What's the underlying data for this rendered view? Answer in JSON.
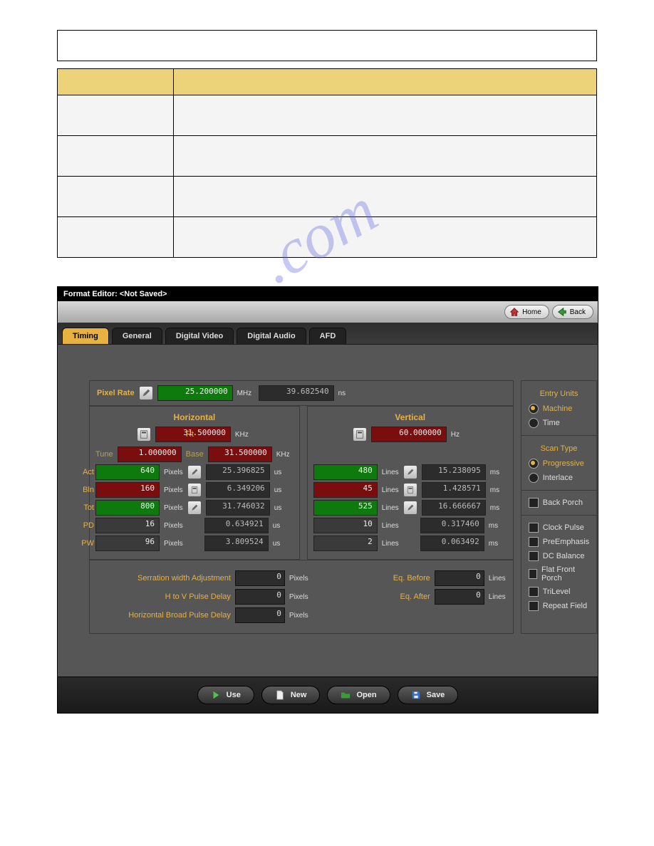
{
  "watermark": ".com",
  "editor": {
    "title": "Format Editor: <Not Saved>",
    "toolbar": {
      "home": "Home",
      "back": "Back"
    },
    "tabs": [
      "Timing",
      "General",
      "Digital Video",
      "Digital Audio",
      "AFD"
    ],
    "activeTab": 0,
    "pixelRate": {
      "label": "Pixel Rate",
      "value": "25.200000",
      "unit": "MHz",
      "secondary": "39.682540",
      "secondaryUnit": "ns"
    },
    "horizontal": {
      "heading": "Horizontal",
      "rtLabel": "Rt",
      "rt": {
        "value": "31.500000",
        "unit": "KHz"
      },
      "tuneLabel": "Tune",
      "tune": "1.000000",
      "baseLabel": "Base",
      "base": "31.500000",
      "baseUnit": "KHz"
    },
    "vertical": {
      "heading": "Vertical",
      "rt": {
        "value": "60.000000",
        "unit": "Hz"
      }
    },
    "rows": {
      "labels": {
        "act": "Act",
        "bln": "Bln",
        "tot": "Tot",
        "pd": "PD",
        "pw": "PW"
      },
      "pixelsUnit": "Pixels",
      "linesUnit": "Lines",
      "usUnit": "us",
      "msUnit": "ms",
      "h": {
        "act": {
          "v": "640",
          "t": "25.396825"
        },
        "bln": {
          "v": "160",
          "t": "6.349206"
        },
        "tot": {
          "v": "800",
          "t": "31.746032"
        },
        "pd": {
          "v": "16",
          "t": "0.634921"
        },
        "pw": {
          "v": "96",
          "t": "3.809524"
        }
      },
      "v": {
        "act": {
          "v": "480",
          "t": "15.238095"
        },
        "bln": {
          "v": "45",
          "t": "1.428571"
        },
        "tot": {
          "v": "525",
          "t": "16.666667"
        },
        "pd": {
          "v": "10",
          "t": "0.317460"
        },
        "pw": {
          "v": "2",
          "t": "0.063492"
        }
      }
    },
    "bottom": {
      "serrationLabel": "Serration width Adjustment",
      "serration": "0",
      "hvDelayLabel": "H to V Pulse Delay",
      "hvDelay": "0",
      "hBroadLabel": "Horizontal Broad Pulse Delay",
      "hBroad": "0",
      "eqBeforeLabel": "Eq. Before",
      "eqBefore": "0",
      "eqAfterLabel": "Eq. After",
      "eqAfter": "0",
      "pixelsUnit": "Pixels",
      "linesUnit": "Lines"
    },
    "side": {
      "entryUnitsTitle": "Entry Units",
      "entryUnits": [
        "Machine",
        "Time"
      ],
      "entryUnitsSelected": 0,
      "scanTypeTitle": "Scan Type",
      "scanType": [
        "Progressive",
        "Interlace"
      ],
      "scanTypeSelected": 0,
      "checks": [
        "Back Porch",
        "Clock Pulse",
        "PreEmphasis",
        "DC Balance",
        "Flat Front Porch",
        "TriLevel",
        "Repeat Field"
      ]
    },
    "actions": {
      "use": "Use",
      "new": "New",
      "open": "Open",
      "save": "Save"
    }
  }
}
